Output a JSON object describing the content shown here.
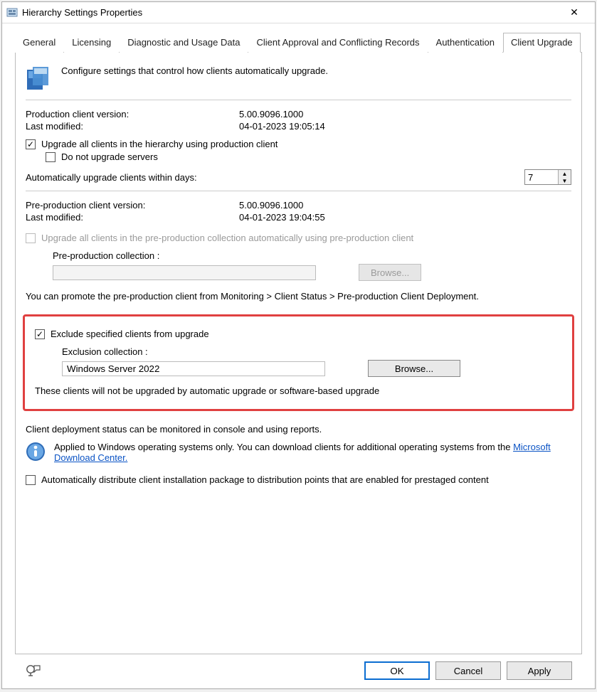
{
  "titlebar": {
    "title": "Hierarchy Settings Properties"
  },
  "tabs": {
    "t0": "General",
    "t1": "Licensing",
    "t2": "Diagnostic and Usage Data",
    "t3": "Client Approval and Conflicting Records",
    "t4": "Authentication",
    "t5": "Client Upgrade"
  },
  "intro": "Configure settings that control how clients automatically upgrade.",
  "prod": {
    "version_label": "Production client version:",
    "version_value": "5.00.9096.1000",
    "modified_label": "Last modified:",
    "modified_value": "04-01-2023 19:05:14"
  },
  "upgrade_all": {
    "label": "Upgrade all clients in the hierarchy using production client",
    "no_servers_label": "Do not upgrade servers",
    "days_label": "Automatically upgrade clients within days:",
    "days_value": "7"
  },
  "preprod": {
    "version_label": "Pre-production client version:",
    "version_value": "5.00.9096.1000",
    "modified_label": "Last modified:",
    "modified_value": "04-01-2023 19:04:55",
    "upgrade_label": "Upgrade all clients in the pre-production collection automatically using pre-production client",
    "collection_label": "Pre-production collection :",
    "browse_label": "Browse...",
    "promote_hint": "You can promote the pre-production client from Monitoring > Client Status > Pre-production Client Deployment."
  },
  "exclude": {
    "checkbox_label": "Exclude specified clients from upgrade",
    "collection_label": "Exclusion collection :",
    "collection_value": "Windows Server 2022",
    "browse_label": "Browse...",
    "note": "These clients will not be upgraded by automatic upgrade or software-based upgrade"
  },
  "status_hint": "Client deployment status can be monitored in console and using reports.",
  "applied_note_prefix": "Applied to Windows operating systems only. You can download clients for additional operating systems from the ",
  "applied_link": "Microsoft Download Center.",
  "autodist_label": "Automatically distribute client installation package to distribution points that are enabled for prestaged content",
  "footer": {
    "ok": "OK",
    "cancel": "Cancel",
    "apply": "Apply"
  }
}
